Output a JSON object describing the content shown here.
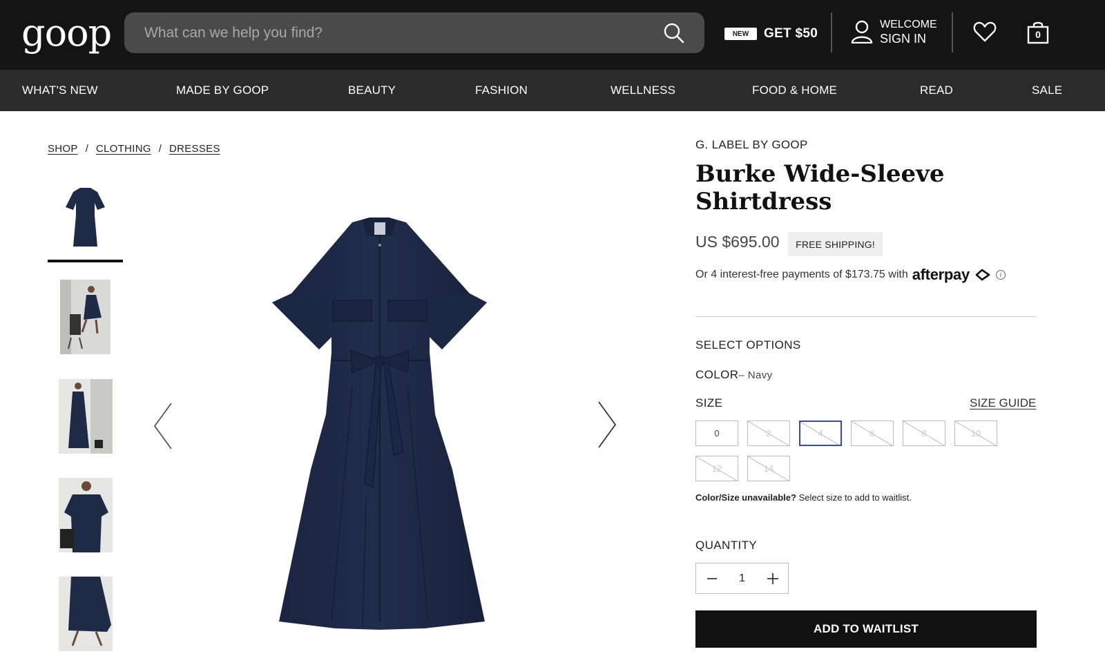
{
  "header": {
    "logo": "goop",
    "search_placeholder": "What can we help you find?",
    "promo_badge": "NEW",
    "promo_text": "GET $50",
    "account_line1": "WELCOME",
    "account_line2": "SIGN IN",
    "cart_count": "0"
  },
  "nav": [
    "WHAT'S NEW",
    "MADE BY GOOP",
    "BEAUTY",
    "FASHION",
    "WELLNESS",
    "FOOD & HOME",
    "READ",
    "SALE"
  ],
  "breadcrumb": [
    "SHOP",
    "CLOTHING",
    "DRESSES"
  ],
  "product": {
    "brand": "G. LABEL BY GOOP",
    "title": "Burke Wide-Sleeve Shirtdress",
    "price": "US $695.00",
    "shipping_badge": "FREE SHIPPING!",
    "installments": "Or 4 interest-free payments of $173.75 with",
    "installment_provider": "afterpay",
    "select_options": "SELECT OPTIONS",
    "color_label": "COLOR",
    "color_value": "– Navy",
    "size_label": "SIZE",
    "size_guide": "SIZE GUIDE",
    "sizes": [
      {
        "label": "0",
        "available": true,
        "selected": false
      },
      {
        "label": "2",
        "available": false,
        "selected": false
      },
      {
        "label": "4",
        "available": false,
        "selected": true
      },
      {
        "label": "6",
        "available": false,
        "selected": false
      },
      {
        "label": "8",
        "available": false,
        "selected": false
      },
      {
        "label": "10",
        "available": false,
        "selected": false
      },
      {
        "label": "12",
        "available": false,
        "selected": false
      },
      {
        "label": "14",
        "available": false,
        "selected": false
      }
    ],
    "waitlist_bold": "Color/Size unavailable?",
    "waitlist_text": "Select size to add to waitlist.",
    "quantity_label": "QUANTITY",
    "quantity": "1",
    "cta": "ADD TO WAITLIST"
  },
  "colors": {
    "header_bg": "#141414",
    "nav_bg": "#2b2b2b",
    "dress": "#1f2a47",
    "selected_size": "#3a4aa0"
  }
}
